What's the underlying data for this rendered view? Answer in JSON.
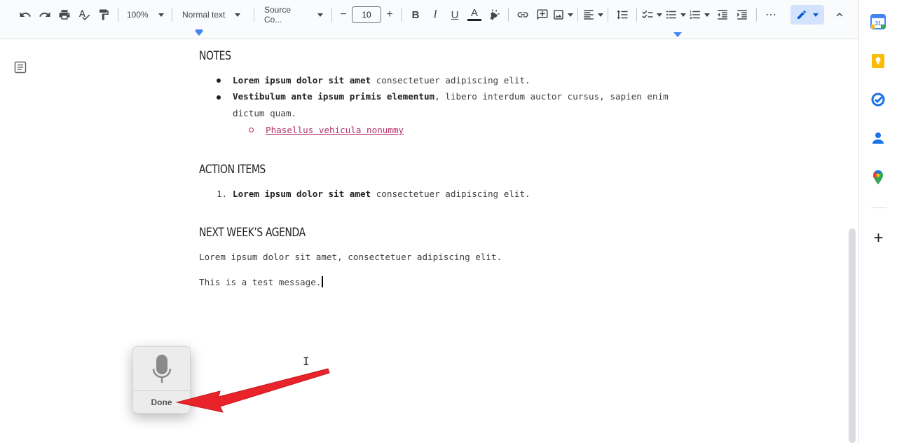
{
  "toolbar": {
    "zoom": "100%",
    "style": "Normal text",
    "font": "Source Co...",
    "font_size": "10",
    "decrease": "−",
    "increase": "+",
    "bold": "B",
    "italic": "I",
    "underline": "U",
    "text_color": "A",
    "more": "⋯",
    "text_color_bar": "#202124"
  },
  "document": {
    "notes_heading": "NOTES",
    "notes_items": [
      {
        "bold": "Lorem ipsum dolor sit amet",
        "text": " consectetuer adipiscing elit."
      },
      {
        "bold": "Vestibulum ante ipsum primis elementum",
        "text": ", libero interdum auctor cursus, sapien enim",
        "continuation": "dictum quam."
      }
    ],
    "notes_subitem_link": "Phasellus vehicula nonummy",
    "action_heading": "ACTION ITEMS",
    "action_number": "1.",
    "action_item": {
      "bold": "Lorem ipsum dolor sit amet",
      "text": " consectetuer adipiscing elit."
    },
    "agenda_heading": "NEXT WEEK’S AGENDA",
    "agenda_para": "Lorem ipsum dolor sit amet, consectetuer adipiscing elit.",
    "test_para": "This is a test message."
  },
  "dictation": {
    "done_label": "Done"
  },
  "colors": {
    "arrow": "#e8232a",
    "link": "#b0306a",
    "accent": "#4285f4"
  },
  "sidepanel": {
    "add_label": "+"
  }
}
